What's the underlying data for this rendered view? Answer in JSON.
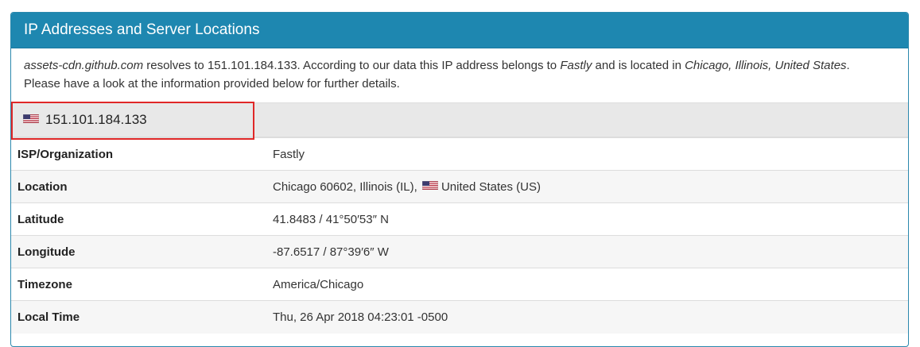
{
  "panel": {
    "title": "IP Addresses and Server Locations"
  },
  "intro": {
    "hostname": "assets-cdn.github.com",
    "text1": " resolves to 151.101.184.133. According to our data this IP address belongs to ",
    "org": "Fastly",
    "text2": " and is located in ",
    "location": "Chicago, Illinois, United States",
    "text3": ".",
    "line2": "Please have a look at the information provided below for further details."
  },
  "ip": {
    "address": "151.101.184.133",
    "flag_icon": "us-flag-icon"
  },
  "rows": [
    {
      "label": "ISP/Organization",
      "value": "Fastly"
    },
    {
      "label": "Location",
      "value_prefix": "Chicago 60602, Illinois (IL),",
      "value": "United States (US)"
    },
    {
      "label": "Latitude",
      "value": "41.8483 / 41°50′53″ N"
    },
    {
      "label": "Longitude",
      "value": "-87.6517 / 87°39′6″ W"
    },
    {
      "label": "Timezone",
      "value": "America/Chicago"
    },
    {
      "label": "Local Time",
      "value": "Thu, 26 Apr 2018 04:23:01 -0500"
    }
  ],
  "colors": {
    "heading_bg": "#1e87b0",
    "highlight": "#e02828"
  }
}
